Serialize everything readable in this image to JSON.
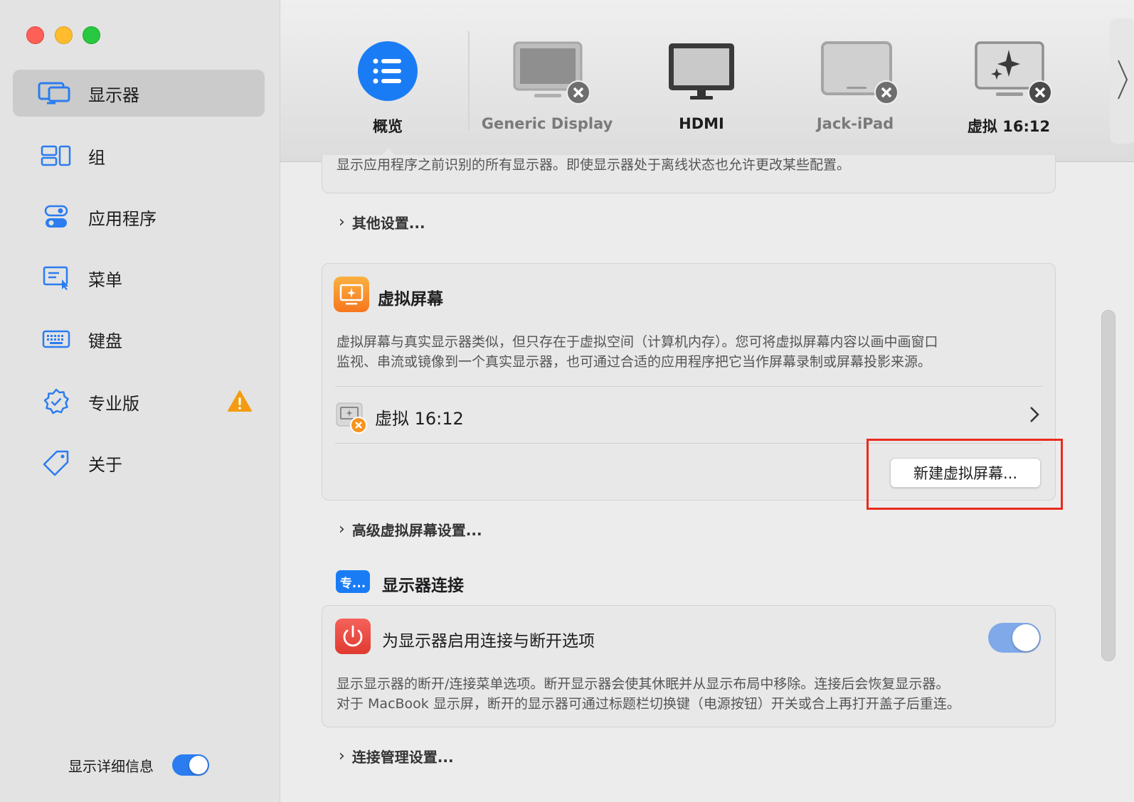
{
  "sidebar": {
    "items": [
      {
        "label": "显示器",
        "icon": "displays-icon",
        "active": true
      },
      {
        "label": "组",
        "icon": "groups-icon"
      },
      {
        "label": "应用程序",
        "icon": "app-toggles-icon"
      },
      {
        "label": "菜单",
        "icon": "menu-cursor-icon"
      },
      {
        "label": "键盘",
        "icon": "keyboard-icon"
      },
      {
        "label": "专业版",
        "icon": "verified-badge-icon",
        "warning": true
      },
      {
        "label": "关于",
        "icon": "tag-icon"
      }
    ],
    "detail_toggle_label": "显示详细信息",
    "detail_toggle_on": true
  },
  "topbar": {
    "displays": [
      {
        "label": "概览",
        "icon": "overview-list-icon"
      },
      {
        "label": "Generic Display",
        "icon": "generic-monitor-icon",
        "disconnected": true
      },
      {
        "label": "HDMI",
        "icon": "hdmi-monitor-icon"
      },
      {
        "label": "Jack-iPad",
        "icon": "ipad-icon",
        "disconnected": true
      },
      {
        "label": "虚拟 16:12",
        "icon": "virtual-monitor-icon",
        "disconnected": true
      }
    ]
  },
  "main": {
    "top_card_desc": "显示应用程序之前识别的所有显示器。即使显示器处于离线状态也允许更改某些配置。",
    "other_settings": "其他设置...",
    "virtual_screen": {
      "title": "虚拟屏幕",
      "desc_line1": "虚拟屏幕与真实显示器类似，但只存在于虚拟空间（计算机内存）。您可将虚拟屏幕内容以画中画窗口",
      "desc_line2": "监视、串流或镜像到一个真实显示器，也可通过合适的应用程序把它当作屏幕录制或屏幕投影来源。",
      "item_label": "虚拟 16:12",
      "new_button": "新建虚拟屏幕..."
    },
    "advanced_virtual": "高级虚拟屏幕设置...",
    "connection": {
      "badge": "专...",
      "title": "显示器连接",
      "option_label": "为显示器启用连接与断开选项",
      "option_on": true,
      "desc_line1": "显示显示器的断开/连接菜单选项。断开显示器会使其休眠并从显示布局中移除。连接后会恢复显示器。",
      "desc_line2": "对于 MacBook 显示屏，断开的显示器可通过标题栏切换键（电源按钮）开关或合上再打开盖子后重连。"
    },
    "connection_settings": "连接管理设置..."
  },
  "colors": {
    "accent_blue": "#2b7cf0",
    "highlight_red": "#ea2b1f",
    "warning_orange": "#f39c12",
    "virtual_orange": "#f7931e",
    "power_red": "#e8443a"
  }
}
